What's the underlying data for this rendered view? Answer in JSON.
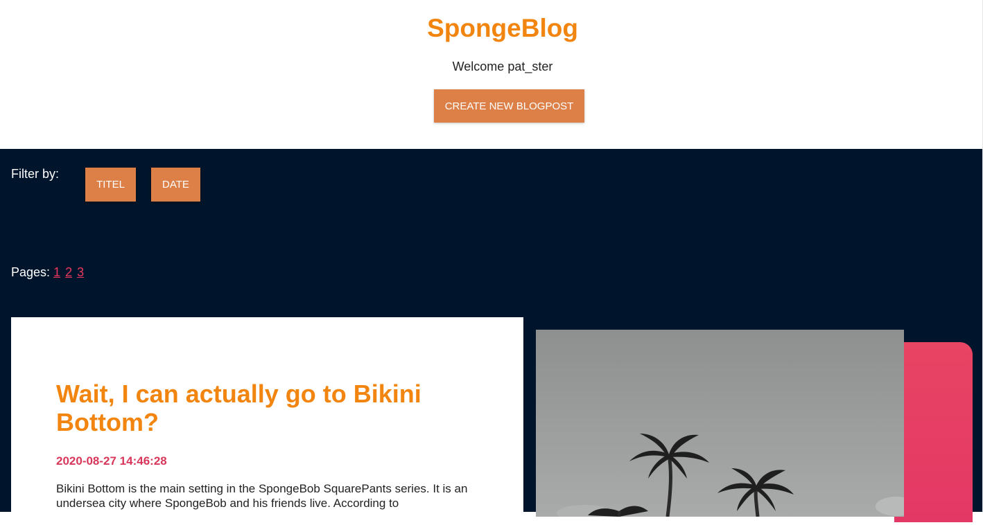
{
  "header": {
    "title": "SpongeBlog",
    "welcome": "Welcome pat_ster",
    "create_button": "CREATE NEW BLOGPOST"
  },
  "filter": {
    "label": "Filter by:",
    "buttons": [
      "TITEL",
      "DATE"
    ]
  },
  "pages": {
    "label": "Pages:",
    "links": [
      "1",
      "2",
      "3"
    ]
  },
  "post": {
    "title": "Wait, I can actually go to Bikini Bottom?",
    "date": "2020-08-27 14:46:28",
    "body": "Bikini Bottom is the main setting in the SpongeBob SquarePants series. It is an undersea city where SpongeBob and his friends live. According to"
  },
  "image": {
    "icon": "palm-trees-photo"
  },
  "colors": {
    "brand_orange": "#f2850f",
    "button_orange": "#dc8048",
    "navy": "#00152b",
    "pink": "#e8385f"
  }
}
